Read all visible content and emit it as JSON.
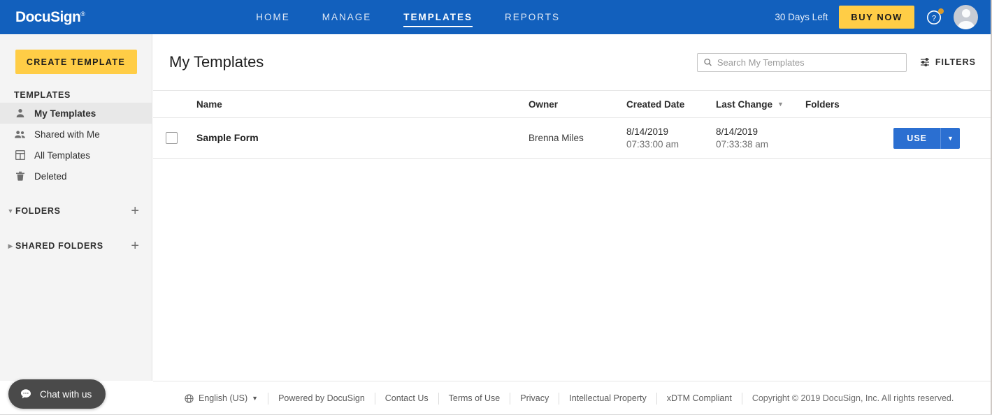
{
  "header": {
    "brand": "DocuSign",
    "brand_tm": "®",
    "nav": [
      {
        "label": "HOME",
        "active": false
      },
      {
        "label": "MANAGE",
        "active": false
      },
      {
        "label": "TEMPLATES",
        "active": true
      },
      {
        "label": "REPORTS",
        "active": false
      }
    ],
    "days_left": "30 Days Left",
    "buy_now": "BUY NOW",
    "help_icon": "help-circle-icon",
    "notification_dot_color": "#d99a2b",
    "avatar_icon": "user-avatar",
    "background_color": "#1260bd",
    "accent_yellow": "#ffcd46"
  },
  "sidebar": {
    "create_button": "CREATE TEMPLATE",
    "section_label": "TEMPLATES",
    "items": [
      {
        "label": "My Templates",
        "icon": "person-icon",
        "active": true
      },
      {
        "label": "Shared with Me",
        "icon": "people-icon",
        "active": false
      },
      {
        "label": "All Templates",
        "icon": "grid-layout-icon",
        "active": false
      },
      {
        "label": "Deleted",
        "icon": "trash-icon",
        "active": false
      }
    ],
    "folders": {
      "label": "FOLDERS",
      "caret": "▼",
      "expanded": true,
      "add": "+"
    },
    "shared_folders": {
      "label": "SHARED FOLDERS",
      "caret": "▶",
      "expanded": false,
      "add": "+"
    }
  },
  "main": {
    "page_title": "My Templates",
    "search": {
      "placeholder": "Search My Templates",
      "value": "",
      "icon": "search-icon"
    },
    "filters": {
      "label": "FILTERS",
      "icon": "sliders-icon"
    },
    "table": {
      "columns": [
        {
          "key": "name",
          "label": "Name"
        },
        {
          "key": "owner",
          "label": "Owner"
        },
        {
          "key": "created",
          "label": "Created Date"
        },
        {
          "key": "changed",
          "label": "Last Change",
          "sorted": true,
          "sort_caret": "▼"
        },
        {
          "key": "folders",
          "label": "Folders"
        }
      ],
      "rows": [
        {
          "checked": false,
          "name": "Sample Form",
          "owner": "Brenna Miles",
          "created_date": "8/14/2019",
          "created_time": "07:33:00 am",
          "changed_date": "8/14/2019",
          "changed_time": "07:33:38 am",
          "folders": "",
          "action": {
            "label": "USE",
            "caret": "▼"
          }
        }
      ]
    }
  },
  "footer": {
    "language": {
      "label": "English (US)",
      "caret": "▼",
      "icon": "globe-icon"
    },
    "links": [
      "Powered by DocuSign",
      "Contact Us",
      "Terms of Use",
      "Privacy",
      "Intellectual Property",
      "xDTM Compliant"
    ],
    "copyright": "Copyright © 2019 DocuSign, Inc. All rights reserved."
  },
  "chat": {
    "label": "Chat with us",
    "icon": "chat-bubble-icon"
  }
}
